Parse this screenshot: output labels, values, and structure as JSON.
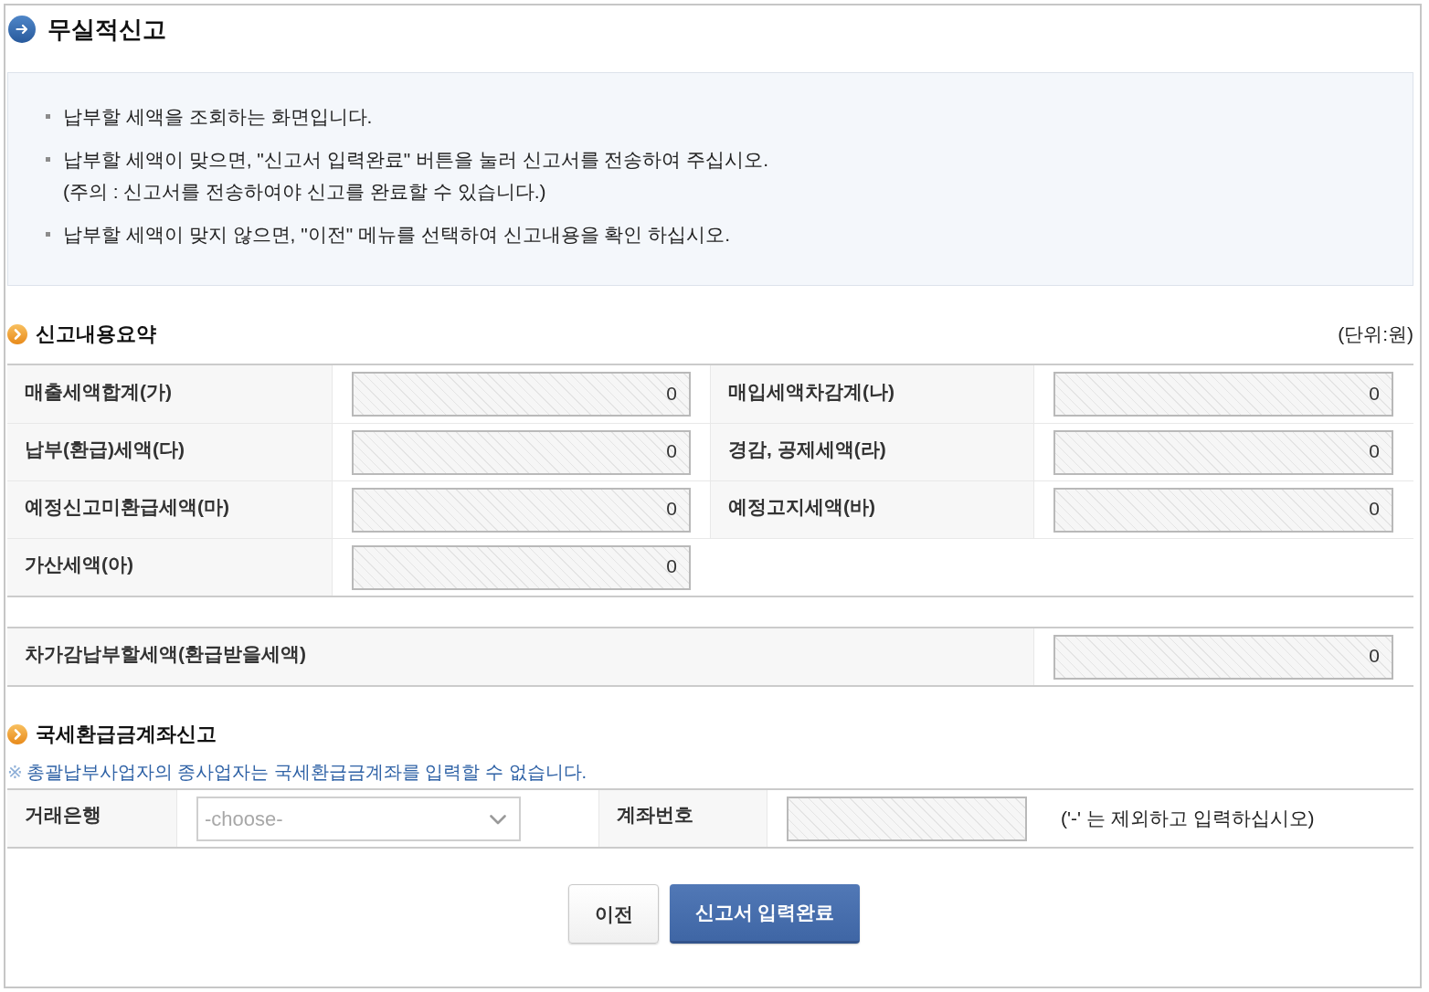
{
  "page": {
    "title": "무실적신고"
  },
  "guide": {
    "items": [
      {
        "text": "납부할 세액을 조회하는 화면입니다."
      },
      {
        "text": "납부할 세액이 맞으면, \"신고서 입력완료\" 버튼을 눌러 신고서를 전송하여 주십시오.",
        "note": "(주의 : 신고서를 전송하여야 신고를 완료할 수 있습니다.)"
      },
      {
        "text": "납부할 세액이 맞지 않으면, \"이전\" 메뉴를 선택하여 신고내용을 확인 하십시오."
      }
    ]
  },
  "summary": {
    "title": "신고내용요약",
    "unit": "(단위:원)",
    "fields": [
      {
        "label": "매출세액합계(가)",
        "value": "0",
        "disabled": true
      },
      {
        "label": "매입세액차감계(나)",
        "value": "0",
        "disabled": true
      },
      {
        "label": "납부(환급)세액(다)",
        "value": "0",
        "disabled": true
      },
      {
        "label": "경감, 공제세액(라)",
        "value": "0",
        "disabled": true
      },
      {
        "label": "예정신고미환급세액(마)",
        "value": "0",
        "disabled": true
      },
      {
        "label": "예정고지세액(바)",
        "value": "0",
        "disabled": true
      },
      {
        "label": "가산세액(아)",
        "value": "0",
        "disabled": true
      }
    ],
    "total": {
      "label": "차가감납부할세액(환급받을세액)",
      "value": "0",
      "disabled": true
    }
  },
  "refund_account": {
    "title": "국세환급금계좌신고",
    "notice_mark": "※",
    "notice": "총괄납부사업자의 종사업자는 국세환급금계좌를 입력할 수 없습니다.",
    "bank": {
      "label": "거래은행",
      "placeholder": "-choose-",
      "disabled": false
    },
    "account_number": {
      "label": "계좌번호",
      "disabled": true,
      "hint": "('-' 는 제외하고 입력하십시오)"
    }
  },
  "buttons": [
    {
      "label": "이전",
      "kind": "secondary"
    },
    {
      "label": "신고서 입력완료",
      "kind": "primary"
    }
  ]
}
